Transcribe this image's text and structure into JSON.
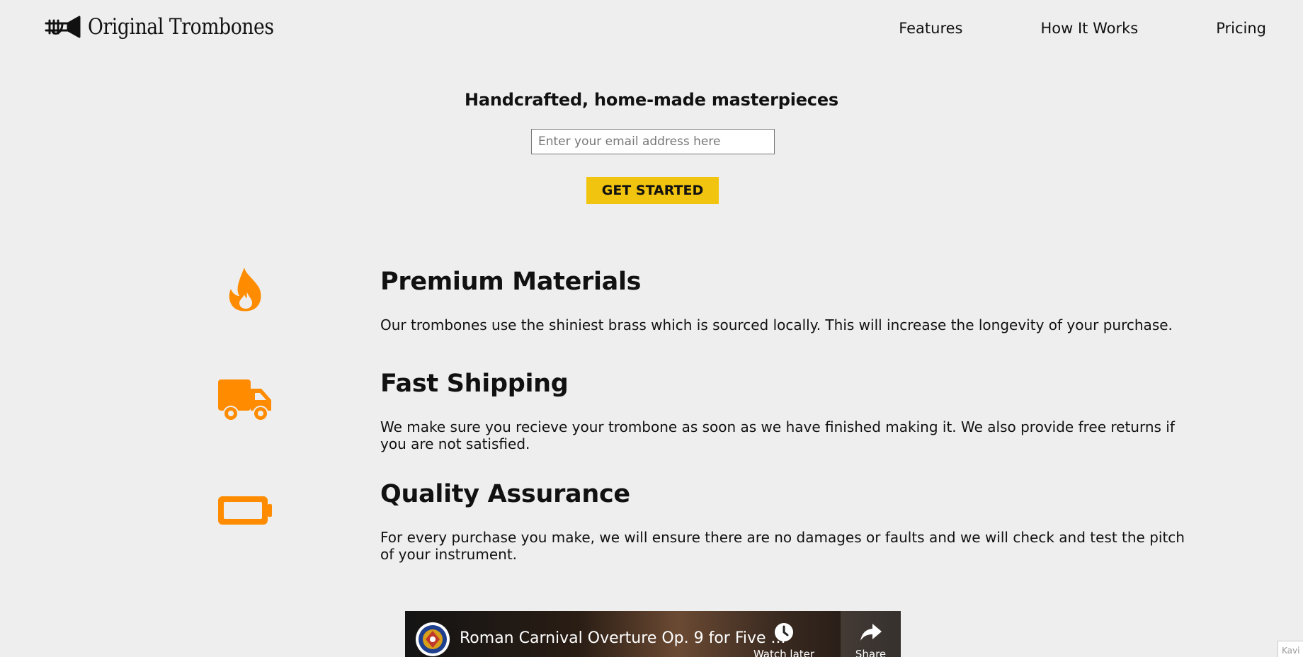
{
  "header": {
    "brand": "Original Trombones",
    "logo_icon": "trombone-icon",
    "nav": [
      {
        "label": "Features"
      },
      {
        "label": "How It Works"
      },
      {
        "label": "Pricing"
      }
    ]
  },
  "hero": {
    "title": "Handcrafted, home-made masterpieces",
    "email_placeholder": "Enter your email address here",
    "email_value": "",
    "cta_label": "GET STARTED"
  },
  "features": [
    {
      "icon": "fire-icon",
      "title": "Premium Materials",
      "description": "Our trombones use the shiniest brass which is sourced locally. This will increase the longevity of your purchase."
    },
    {
      "icon": "truck-icon",
      "title": "Fast Shipping",
      "description": "We make sure you recieve your trombone as soon as we have finished making it. We also provide free returns if you are not satisfied."
    },
    {
      "icon": "battery-icon",
      "title": "Quality Assurance",
      "description": "For every purchase you make, we will ensure there are no damages or faults and we will check and test the pitch of your instrument."
    }
  ],
  "video": {
    "title": "Roman Carnival Overture Op. 9 for Five ...",
    "watch_later_label": "Watch later",
    "share_label": "Share"
  },
  "corner_widget": {
    "label": "Kavi"
  },
  "colors": {
    "background": "#eeeeee",
    "accent": "#f1c40f",
    "icon": "#ff8c00"
  }
}
